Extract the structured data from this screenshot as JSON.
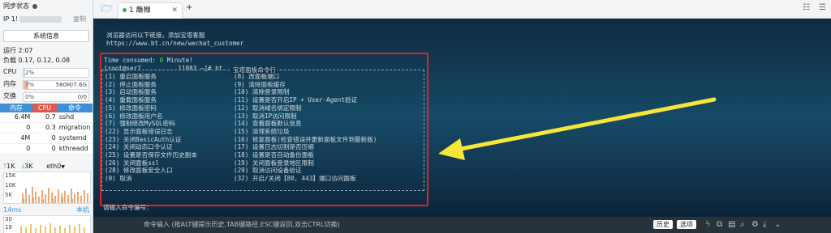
{
  "sidebar": {
    "sync_label": "同步状态",
    "ip_label": "IP",
    "ip_value": "1!",
    "copy_label": "复制",
    "sysinfo_button": "系统信息",
    "uptime": "运行 2:07",
    "load": "负载 0.17, 0.12, 0.08",
    "cpu_label": "CPU",
    "cpu_value": "2%",
    "cpu_fraction": 0.02,
    "mem_label": "内存",
    "mem_value": "7%",
    "mem_fraction": 0.07,
    "mem_detail": "580M/7.6G",
    "swap_label": "交换",
    "swap_value": "0%",
    "swap_detail": "0/0",
    "swap_fraction": 0.0,
    "process_headers": [
      "内存",
      "CPU",
      "命令"
    ],
    "processes": [
      {
        "mem": "6.4M",
        "cpu": "0.7",
        "cmd": "sshd"
      },
      {
        "mem": "0",
        "cpu": "0.3",
        "cmd": "migration"
      },
      {
        "mem": "4M",
        "cpu": "0",
        "cmd": "systemd"
      },
      {
        "mem": "0",
        "cpu": "0",
        "cmd": "kthreadd"
      }
    ],
    "net_up": "1K",
    "net_down": "3K",
    "net_iface": "eth0",
    "net_scale": [
      "15K",
      "10K",
      "5K"
    ],
    "ping_label": "14ms",
    "ping_target": "本机",
    "ping_scale": [
      "30",
      "18"
    ]
  },
  "topbar": {
    "tab_label": "1 蘸橼",
    "add_tab": "+"
  },
  "terminal": {
    "intro_lines": [
      "浏览器访问以下链接，添加宝塔客服",
      "https://www.bt.cn/new/wechat_customer"
    ],
    "time_prefix": "Time consumed: ",
    "time_value": "0",
    "time_suffix": " Minute!",
    "prompt": "[root@ser7          11883 ~]# bt",
    "menu_title": "宝塔面板命令行",
    "menu_left": [
      "(1) 重启面板服务",
      "(2) 停止面板服务",
      "(3) 启动面板服务",
      "(4) 重载面板服务",
      "(5) 修改面板密码",
      "(6) 修改面板用户名",
      "(7) 强制修改MySQL密码",
      "(22) 显示面板错误日志",
      "(23) 关闭BasicAuth认证",
      "(24) 关闭动态口令认证",
      "(25) 设置是否保存文件历史副本",
      "(26) 关闭面板ssl",
      "(28) 修改面板安全入口",
      "(0) 取消"
    ],
    "menu_right": [
      "(8) 改面板端口",
      "(9) 清除面板缓存",
      "(10) 清除登录限制",
      "(11) 设置是否开启IP + User-Agent验证",
      "(12) 取消域名绑定限制",
      "(13) 取消IP访问限制",
      "(14) 查看面板默认信息",
      "(15) 清理系统垃圾",
      "(16) 修复面板(检查错误并更新面板文件到最新版)",
      "(17) 设置日志切割是否压缩",
      "(18) 设置是否自动备份面板",
      "(19) 关闭面板登录地区限制",
      "(29) 取消访问设备验证",
      "(32) 开启/关闭【80, 443】端口访问面板"
    ],
    "input_prompt": "请输入命令编号："
  },
  "bottombar": {
    "hint": "命令输入 (按ALT键提示历史,TAB键路径,ESC键返回,双击CTRL切换)",
    "history_button": "历史",
    "options_button": "选项"
  },
  "colors": {
    "accent_blue": "#3f8fd8",
    "red_box": "#e02424",
    "arrow_yellow": "#f7e53a",
    "green": "#5bd35b"
  }
}
